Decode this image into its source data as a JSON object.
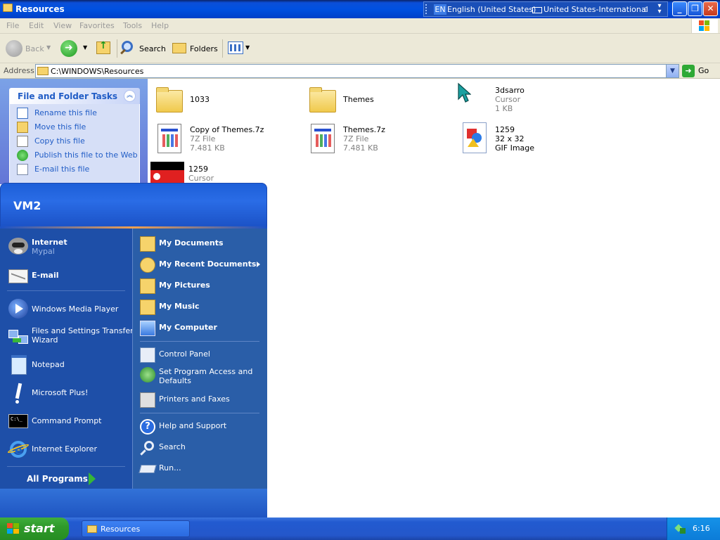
{
  "window": {
    "title": "Resources"
  },
  "langbar": {
    "code": "EN",
    "language": "English (United States)",
    "keyboard": "United States-International"
  },
  "menu": [
    "File",
    "Edit",
    "View",
    "Favorites",
    "Tools",
    "Help"
  ],
  "toolbar": {
    "back": "Back",
    "search": "Search",
    "folders": "Folders"
  },
  "address": {
    "label": "Address",
    "path": "C:\\WINDOWS\\Resources",
    "go": "Go"
  },
  "tasks": {
    "header": "File and Folder Tasks",
    "items": [
      "Rename this file",
      "Move this file",
      "Copy this file",
      "Publish this file to the Web",
      "E-mail this file"
    ]
  },
  "files": [
    {
      "name": "1033",
      "type": "",
      "size": ""
    },
    {
      "name": "Themes",
      "type": "",
      "size": ""
    },
    {
      "name": "3dsarro",
      "type": "Cursor",
      "size": "1 KB"
    },
    {
      "name": "Copy of Themes.7z",
      "type": "7Z File",
      "size": "7.481 KB"
    },
    {
      "name": "Themes.7z",
      "type": "7Z File",
      "size": "7.481 KB"
    },
    {
      "name": "1259",
      "type": "32 x 32",
      "size": "GIF Image"
    },
    {
      "name": "1259",
      "type": "Cursor",
      "size": ""
    }
  ],
  "startmenu": {
    "user": "VM2",
    "pinned": [
      {
        "title": "Internet",
        "sub": "Mypal"
      },
      {
        "title": "E-mail",
        "sub": ""
      }
    ],
    "recent": [
      "Windows Media Player",
      "Files and Settings Transfer",
      "Wizard",
      "Notepad",
      "Microsoft Plus!",
      "Command Prompt",
      "Internet Explorer"
    ],
    "all_programs": "All Programs",
    "right": [
      "My Documents",
      "My Recent Documents",
      "My Pictures",
      "My Music",
      "My Computer",
      "Control Panel",
      "Set Program Access and",
      "Defaults",
      "Printers and Faxes",
      "Help and Support",
      "Search",
      "Run..."
    ]
  },
  "taskbar": {
    "start": "start",
    "window": "Resources",
    "clock": "6:16"
  }
}
